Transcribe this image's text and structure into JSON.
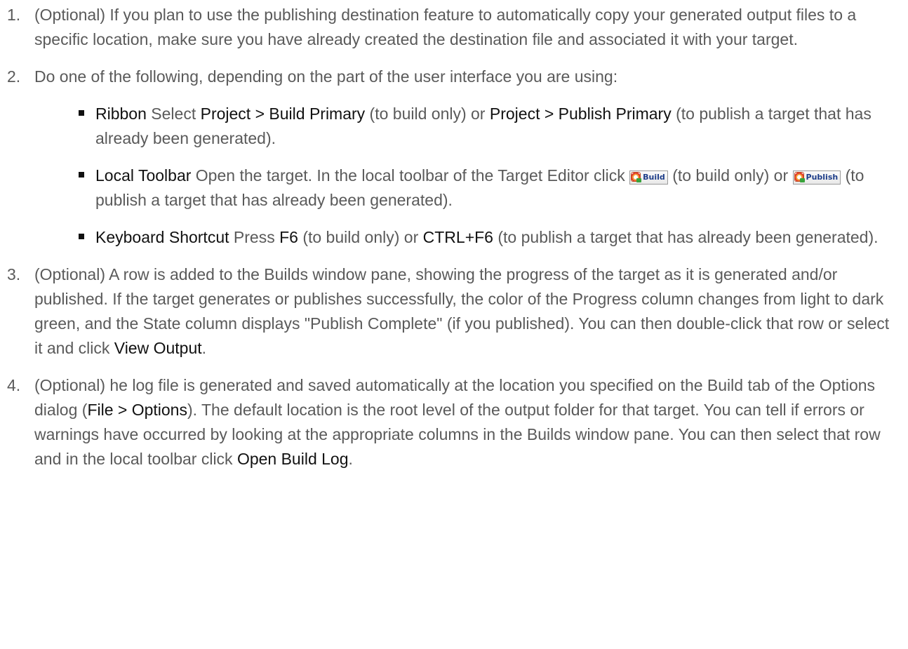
{
  "steps": [
    {
      "number": "1.",
      "text": "(Optional) If you plan to use the publishing destination feature to automatically copy your generated output files to a specific location, make sure you have already created the destination file and associated it with your target."
    },
    {
      "number": "2.",
      "text": "Do one of the following, depending on the part of the user interface you are using:",
      "bullets": {
        "ribbon": {
          "title": "Ribbon",
          "t1": " Select ",
          "b1": "Project > Build Primary",
          "t2": " (to build only) or ",
          "b2": "Project > Publish Primary",
          "t3": " (to publish a target that has already been generated)."
        },
        "toolbar": {
          "title": "Local Toolbar",
          "t1": " Open the target. In the local toolbar of the Target Editor click ",
          "build_button": "Build",
          "t2": " (to build only) or ",
          "publish_button": "Publish",
          "t3": " (to publish a target that has already been generated)."
        },
        "shortcut": {
          "title": "Keyboard Shortcut",
          "t1": " Press ",
          "b1": "F6",
          "t2": " (to build only) or ",
          "b2": "CTRL+F6",
          "t3": " (to publish a target that has already been generated)."
        }
      }
    },
    {
      "number": "3.",
      "text": "(Optional) A row is added to the Builds window pane, showing the progress of the target as it is generated and/or published. If the target generates or publishes successfully, the color of the Progress column changes from light to dark green, and the State column displays \"Publish Complete\" (if you published). You can then double-click that row or select it and click ",
      "bold_end": "View Output",
      "end": "."
    },
    {
      "number": "4.",
      "t1": "(Optional)  he log file is generated and saved automatically at the location you specified on the Build tab of the Options dialog (",
      "b1": "File > Options",
      "t2": "). The default location is the root level of the output folder for that target. You can tell if errors or warnings have occurred by looking at the appropriate columns in the Builds window pane. You can then select that row and in the local toolbar click ",
      "b2": "Open Build Log",
      "t3": "."
    }
  ]
}
